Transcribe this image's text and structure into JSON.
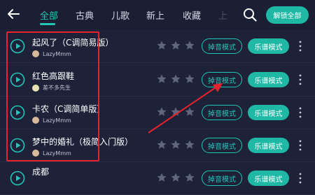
{
  "header": {
    "tabs": [
      {
        "label": "全部",
        "active": true
      },
      {
        "label": "古典",
        "active": false
      },
      {
        "label": "儿歌",
        "active": false
      },
      {
        "label": "新上",
        "active": false
      },
      {
        "label": "收藏",
        "active": false
      },
      {
        "label": "上",
        "active": false
      }
    ],
    "unlock_label": "解锁全部"
  },
  "songs": [
    {
      "title": "起风了（C调简易版）",
      "author": "LazyMmm",
      "remove_label": "掉音模式",
      "score_label": "乐谱模式"
    },
    {
      "title": "红色高跟鞋",
      "author": "差不多先生",
      "remove_label": "掉音模式",
      "score_label": "乐谱模式"
    },
    {
      "title": "卡农（C调简单版）",
      "author": "LazyMmm",
      "remove_label": "掉音模式",
      "score_label": "乐谱模式"
    },
    {
      "title": "梦中的婚礼（极简入门版）",
      "author": "LazyMmm",
      "remove_label": "掉音模式",
      "score_label": "乐谱模式"
    },
    {
      "title": "成都",
      "author": "",
      "remove_label": "掉音模式",
      "score_label": "乐谱模式"
    }
  ],
  "colors": {
    "accent": "#1fb8a5",
    "background": "#1d2238",
    "annotation": "#e8222c"
  },
  "icons": {
    "back": "back-arrow-icon",
    "search": "search-icon",
    "play": "play-icon",
    "star": "star-icon",
    "more": "more-vertical-icon"
  }
}
